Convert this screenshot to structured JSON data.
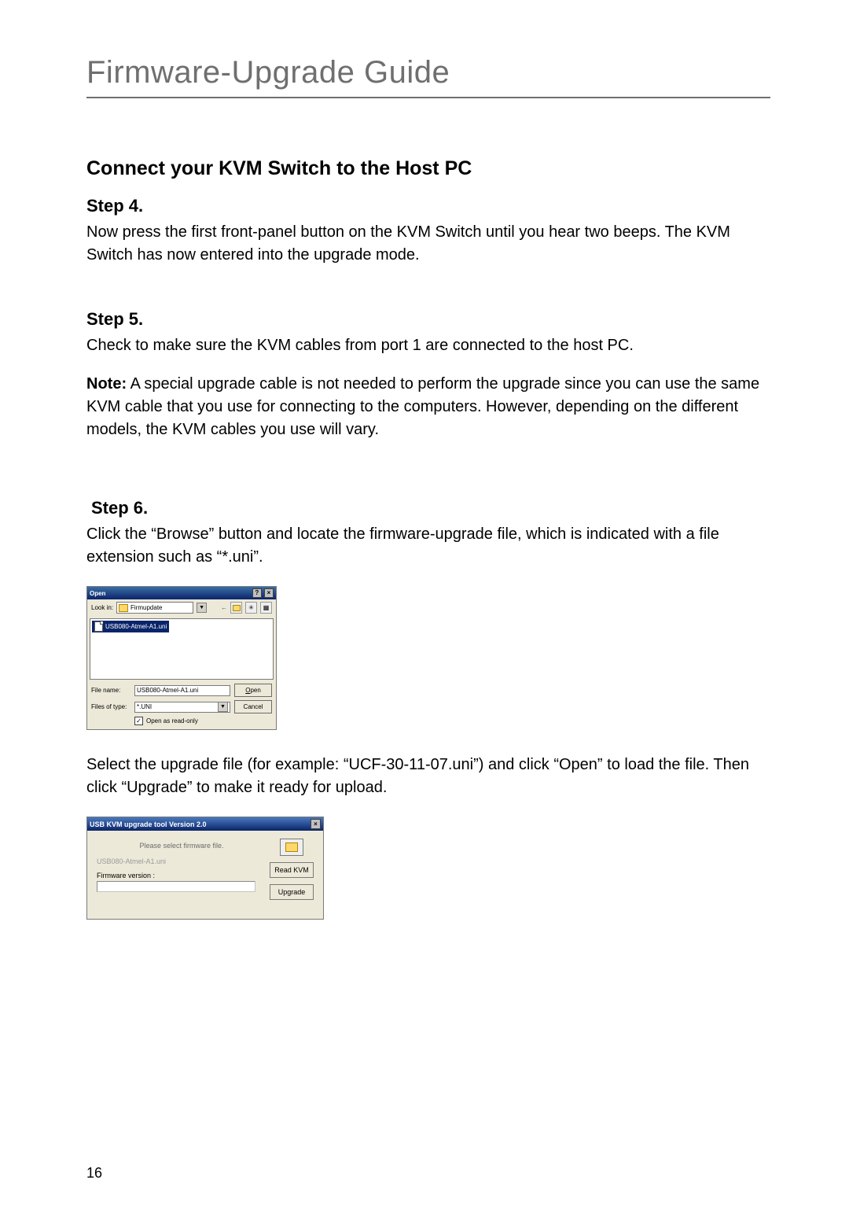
{
  "doc_title": "Firmware-Upgrade Guide",
  "section_title": "Connect your KVM Switch to the Host PC",
  "step4": {
    "heading": "Step 4.",
    "text": "Now press the first front-panel button on the KVM Switch until you hear two beeps. The KVM Switch has now entered into the upgrade mode."
  },
  "step5": {
    "heading": "Step 5.",
    "text": "Check to make sure the KVM cables from port 1 are connected to the host PC.",
    "note_label": "Note:",
    "note_text": " A special upgrade cable is not needed to perform the upgrade since you can use the same KVM cable that you use for connecting to the computers. However, depending on the different models, the KVM cables you use will vary."
  },
  "step6": {
    "heading": "Step 6.",
    "text1": "Click the “Browse” button and locate the firmware-upgrade file, which is indicated with a file extension such as “*.uni”.",
    "text2": "Select the upgrade file (for example: “UCF-30-11-07.uni”) and click “Open” to load the file. Then click “Upgrade” to make it ready for upload."
  },
  "open_dialog": {
    "title": "Open",
    "lookin_label": "Look in:",
    "lookin_value": "Firmupdate",
    "file_selected": "USB080-Atmel-A1.uni",
    "filename_label": "File name:",
    "filename_value": "USB080-Atmel-A1.uni",
    "filetype_label": "Files of type:",
    "filetype_value": "*.UNI",
    "open_btn": "Open",
    "cancel_btn": "Cancel",
    "readonly_label": "Open as read-only"
  },
  "tool_dialog": {
    "title": "USB KVM upgrade tool Version 2.0",
    "prompt": "Please select firmware file.",
    "file_shown": "USB080-Atmel-A1.uni",
    "fw_label": "Firmware version :",
    "read_btn": "Read KVM",
    "upgrade_btn": "Upgrade"
  },
  "page_number": "16"
}
